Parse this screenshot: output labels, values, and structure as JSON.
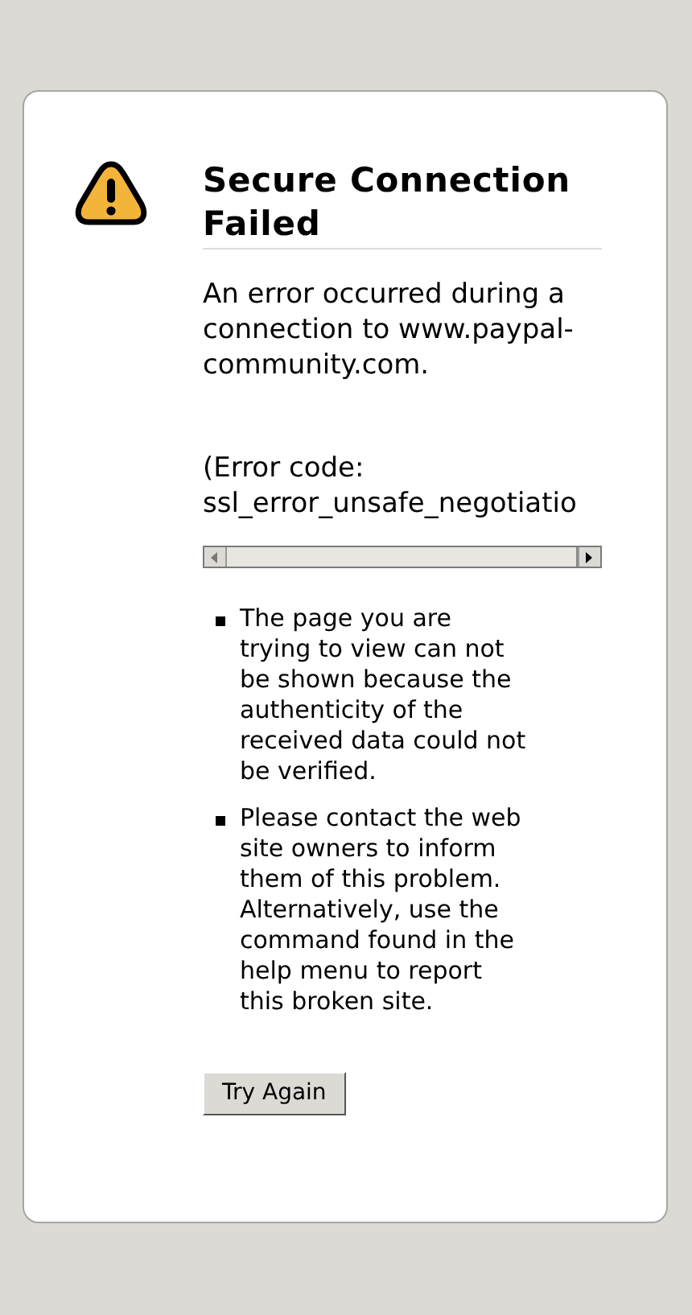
{
  "title": "Secure Connection Failed",
  "message": "An error occurred during a connection to www.paypal-community.com.",
  "error_code": "(Error code: ssl_error_unsafe_negotiatio",
  "bullets": [
    "The page you are trying to view can not be shown because the authenticity of the received data could not be verified.",
    "Please contact the web site owners to inform them of this problem. Alternatively, use the command found in the help menu to report this broken site."
  ],
  "button": "Try Again"
}
